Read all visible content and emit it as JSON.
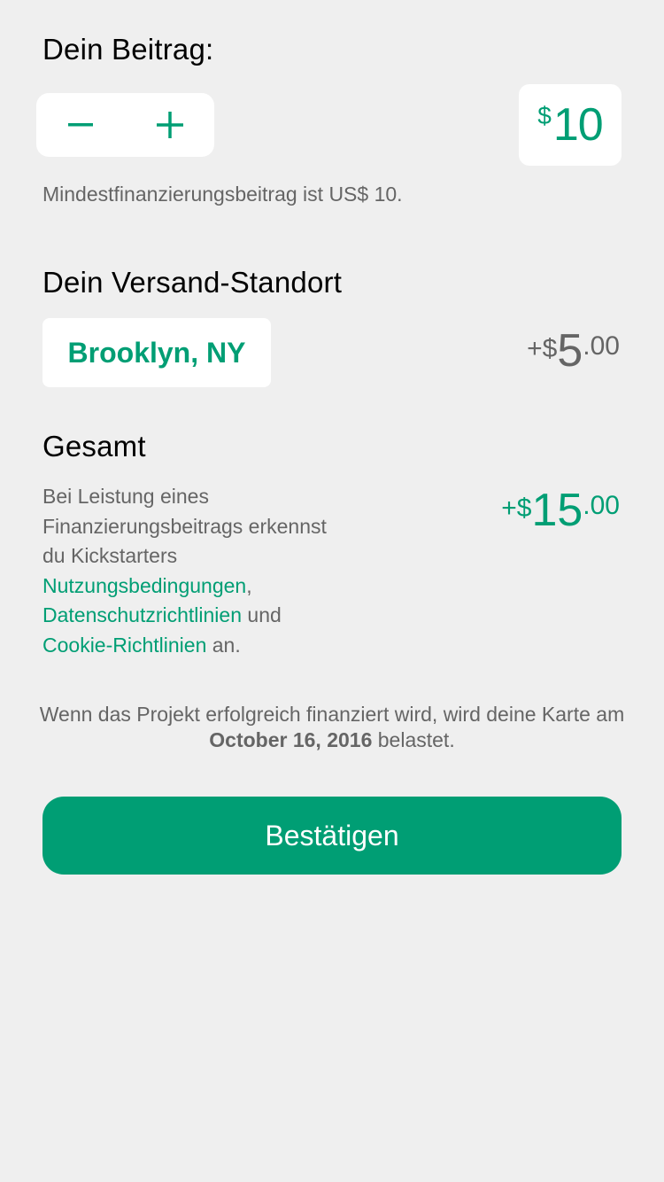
{
  "pledge": {
    "title": "Dein Beitrag:",
    "amount_currency": "$",
    "amount_value": "10",
    "minimum_hint": "Mindestfinanzierungsbeitrag ist US$ 10."
  },
  "shipping": {
    "title": "Dein Versand-Standort",
    "location": "Brooklyn, NY",
    "price_sign": "+$",
    "price_main": "5",
    "price_cents": ".00"
  },
  "total": {
    "title": "Gesamt",
    "price_sign": "+$",
    "price_main": "15",
    "price_cents": ".00",
    "legal_prefix": "Bei Leistung eines Finanzierungsbeitrags erkennst du Kickstarters ",
    "link_terms": "Nutzungsbedingungen",
    "sep_comma": ",",
    "link_privacy": "Datenschutzrichtlinien",
    "sep_and": " und ",
    "link_cookies": "Cookie-Richtlinien",
    "legal_suffix": " an."
  },
  "charge_note": {
    "prefix": "Wenn das Projekt erfolgreich finanziert wird, wird deine Karte am ",
    "date": "October 16, 2016",
    "suffix": " belastet."
  },
  "confirm_label": "Bestätigen",
  "colors": {
    "accent": "#009e74",
    "background": "#efefef",
    "muted_text": "#656565"
  },
  "icons": {
    "decrement": "minus-icon",
    "increment": "plus-icon"
  }
}
